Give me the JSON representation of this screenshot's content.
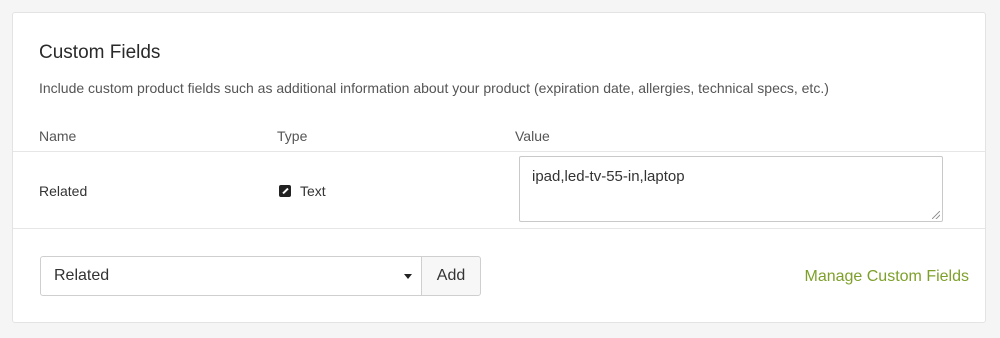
{
  "custom_fields": {
    "title": "Custom Fields",
    "description": "Include custom product fields such as additional information about your product (expiration date, allergies, technical specs, etc.)",
    "columns": {
      "name": "Name",
      "type": "Type",
      "value": "Value"
    },
    "rows": [
      {
        "name": "Related",
        "type": "Text",
        "type_icon": "edit-pencil-icon",
        "value": "ipad,led-tv-55-in,laptop"
      }
    ],
    "add_field": {
      "selected_option": "Related",
      "add_label": "Add"
    },
    "manage_link": "Manage Custom Fields",
    "colors": {
      "link": "#7ea02a",
      "border": "#cfcfcf"
    }
  }
}
